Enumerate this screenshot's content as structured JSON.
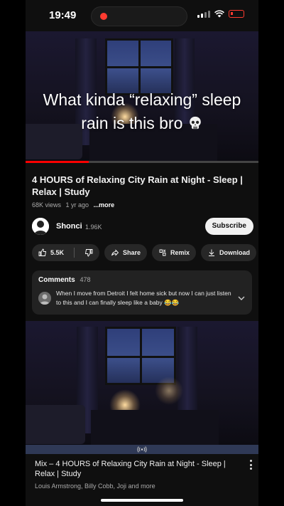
{
  "status_bar": {
    "time": "19:49"
  },
  "video": {
    "overlay_line1": "What kinda “relaxing” sleep",
    "overlay_line2": "rain is this bro",
    "progress": 0.27,
    "title": "4 HOURS of Relaxing City Rain at Night - Sleep | Relax | Study",
    "views": "68K views",
    "age": "1 yr ago",
    "more_label": "...more"
  },
  "channel": {
    "name": "Shonci",
    "subscribers": "1.96K",
    "subscribe_label": "Subscribe"
  },
  "actions": {
    "like_count": "5.5K",
    "share_label": "Share",
    "remix_label": "Remix",
    "download_label": "Download"
  },
  "comments": {
    "heading": "Comments",
    "count": "478",
    "top_comment": "When I move from Detroit I felt home sick but now I can just listen to this and I can finally sleep like a baby 😂😂"
  },
  "next_item": {
    "title": "Mix – 4 HOURS of Relaxing City Rain at Night - Sleep | Relax | Study",
    "artists": "Louis Armstrong, Billy Cobb, Joji and more"
  },
  "colors": {
    "background": "#0f0f0f",
    "pill": "#272727",
    "accent_red": "#ff0000",
    "mix_bar": "#2f3956"
  },
  "icons": [
    "signal-icon",
    "wifi-icon",
    "battery-icon",
    "skull-icon",
    "like-icon",
    "dislike-icon",
    "share-icon",
    "remix-icon",
    "download-icon",
    "chevron-down-icon",
    "live-icon",
    "more-vert-icon"
  ]
}
